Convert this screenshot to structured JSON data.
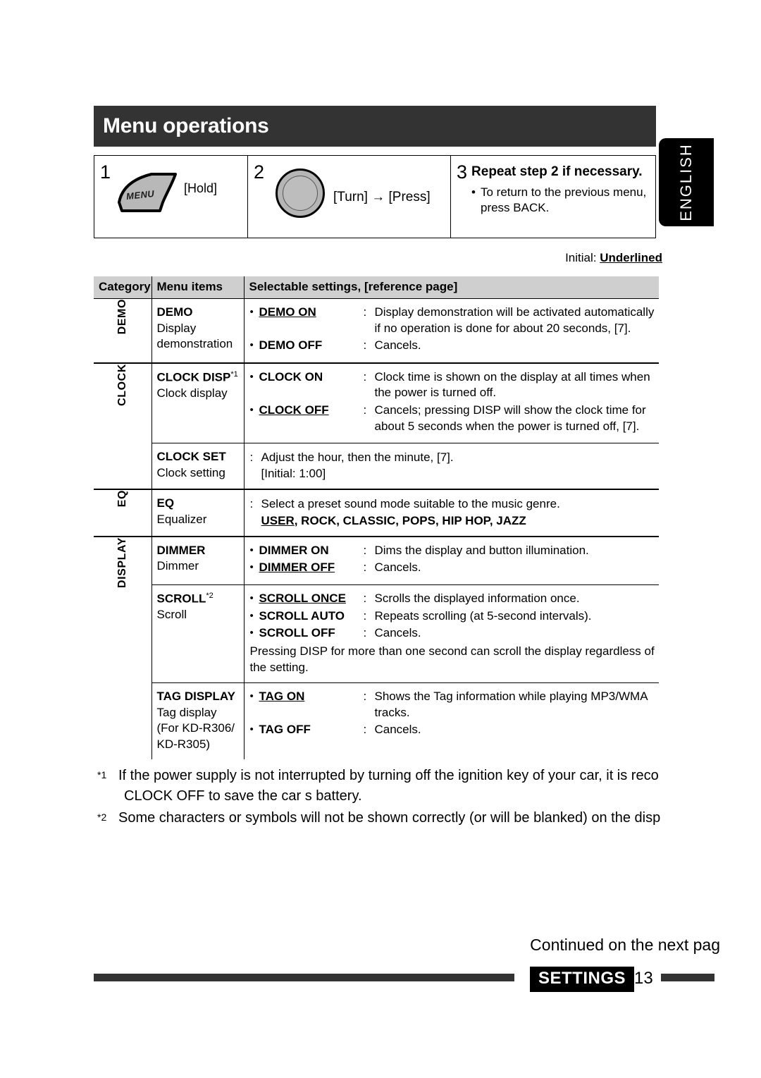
{
  "language_tab": "ENGLISH",
  "title": "Menu operations",
  "steps": [
    {
      "number": "1",
      "icon": "menu-button-icon",
      "icon_label": "MENU",
      "action": "[Hold]"
    },
    {
      "number": "2",
      "icon": "rotary-knob-icon",
      "action": "[Turn] → [Press]"
    },
    {
      "number": "3",
      "heading": "Repeat step 2 if necessary.",
      "bullet": "To return to the previous menu, press BACK."
    }
  ],
  "initial_note": {
    "prefix": "Initial: ",
    "emphasis": "Underlined"
  },
  "table": {
    "headers": [
      "Category",
      "Menu items",
      "Selectable settings, [reference page]"
    ],
    "rows": [
      {
        "category": "DEMO",
        "item_name": "DEMO",
        "item_footnote": "",
        "item_sub": "Display demonstration",
        "item_sub_lines": [
          "Display",
          "demonstration"
        ],
        "options": [
          {
            "name": "DEMO ON",
            "underlined": true,
            "desc": "Display demonstration will be activated automatically if no operation is done for about 20 seconds, [7]."
          },
          {
            "name": "DEMO OFF",
            "underlined": false,
            "desc": "Cancels."
          }
        ]
      },
      {
        "category": "CLOCK",
        "item_name": "CLOCK DISP",
        "item_footnote": "*1",
        "item_sub_lines": [
          "Clock display"
        ],
        "options": [
          {
            "name": "CLOCK ON",
            "underlined": false,
            "desc": "Clock time is shown on the display at all times when the power is turned off."
          },
          {
            "name": "CLOCK OFF",
            "underlined": true,
            "desc": "Cancels; pressing DISP will show the clock time for about 5 seconds when the power is turned off, [7]."
          }
        ]
      },
      {
        "category": "",
        "item_name": "CLOCK SET",
        "item_footnote": "",
        "item_sub_lines": [
          "Clock setting"
        ],
        "plain_lines": [
          "Adjust the hour, then the minute, [7].",
          "[Initial: 1:00]"
        ],
        "options": []
      },
      {
        "category": "EQ",
        "item_name": "EQ",
        "item_footnote": "",
        "item_sub_lines": [
          "Equalizer"
        ],
        "plain_lines": [
          "Select a preset sound mode suitable to the music genre."
        ],
        "values_underlined": "USER",
        "values_rest": ", ROCK, CLASSIC, POPS, HIP HOP, JAZZ",
        "options": []
      },
      {
        "category": "DISPLAY",
        "item_name": "DIMMER",
        "item_footnote": "",
        "item_sub_lines": [
          "Dimmer"
        ],
        "options": [
          {
            "name": "DIMMER ON",
            "underlined": false,
            "desc": "Dims the display and button illumination."
          },
          {
            "name": "DIMMER OFF",
            "underlined": true,
            "desc": "Cancels."
          }
        ]
      },
      {
        "category": "",
        "item_name": "SCROLL",
        "item_footnote": "*2",
        "item_sub_lines": [
          "Scroll"
        ],
        "options": [
          {
            "name": "SCROLL ONCE",
            "underlined": true,
            "desc": "Scrolls the displayed information once."
          },
          {
            "name": "SCROLL AUTO",
            "underlined": false,
            "desc": "Repeats scrolling (at 5-second intervals)."
          },
          {
            "name": "SCROLL OFF",
            "underlined": false,
            "desc": "Cancels."
          }
        ],
        "note": "Pressing DISP for more than one second can scroll the display regardless of the setting."
      },
      {
        "category": "",
        "item_name": "TAG DISPLAY",
        "item_footnote": "",
        "item_sub_lines": [
          "Tag display",
          "(For KD-R306/",
          "KD-R305)"
        ],
        "options": [
          {
            "name": "TAG ON",
            "underlined": true,
            "desc": "Shows the Tag information while playing MP3/WMA tracks."
          },
          {
            "name": "TAG OFF",
            "underlined": false,
            "desc": "Cancels."
          }
        ]
      }
    ]
  },
  "footnotes": [
    {
      "mark": "*1",
      "line1": "If the power supply is not interrupted by turning off the ignition key of your car, it is reco",
      "line2": "CLOCK OFF  to save the car s battery."
    },
    {
      "mark": "*2",
      "line1": "Some characters or symbols will not be shown correctly (or will be blanked) on the disp",
      "line2": ""
    }
  ],
  "continued_text": "Continued on the next pag",
  "footer": {
    "section_label": "SETTINGS",
    "page_number": "13"
  }
}
